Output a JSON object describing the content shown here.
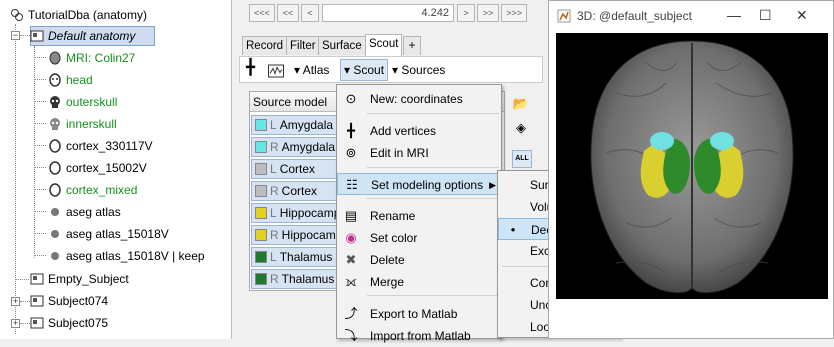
{
  "tree": {
    "items": [
      {
        "label": "TutorialDba (anatomy)"
      },
      {
        "label": "Default anatomy"
      },
      {
        "label": "MRI: Colin27"
      },
      {
        "label": "head"
      },
      {
        "label": "outerskull"
      },
      {
        "label": "innerskull"
      },
      {
        "label": "cortex_330117V"
      },
      {
        "label": "cortex_15002V"
      },
      {
        "label": "cortex_mixed"
      },
      {
        "label": "aseg atlas"
      },
      {
        "label": "aseg atlas_15018V"
      },
      {
        "label": "aseg atlas_15018V | keep"
      },
      {
        "label": "Empty_Subject"
      },
      {
        "label": "Subject074"
      },
      {
        "label": "Subject075"
      }
    ],
    "green_color": "#16901e"
  },
  "nav": {
    "buttons": [
      "<<<",
      "<<",
      "<",
      ">",
      ">>",
      ">>>"
    ],
    "time_value": "4.242"
  },
  "tabs": [
    "Record",
    "Filter",
    "Surface",
    "Scout",
    "+"
  ],
  "toolbar": {
    "atlas_label": "Atlas",
    "scout_label": "Scout",
    "sources_label": "Sources"
  },
  "scout_list": {
    "header": "Source model",
    "rows": [
      {
        "side": "L",
        "name": "Amygdala",
        "color": "#66e6e6"
      },
      {
        "side": "R",
        "name": "Amygdala",
        "color": "#66e6e6"
      },
      {
        "side": "L",
        "name": "Cortex",
        "color": "#bdbdbd"
      },
      {
        "side": "R",
        "name": "Cortex",
        "color": "#bdbdbd"
      },
      {
        "side": "L",
        "name": "Hippocampus",
        "color": "#e0d020"
      },
      {
        "side": "R",
        "name": "Hippocampus",
        "color": "#e0d020"
      },
      {
        "side": "L",
        "name": "Thalamus",
        "color": "#1f7a2a"
      },
      {
        "side": "R",
        "name": "Thalamus",
        "color": "#1f7a2a"
      }
    ],
    "all_label": "ALL"
  },
  "menu": {
    "items": [
      {
        "label": "New: coordinates",
        "icon": "crosshair-target-icon"
      },
      {
        "label": "Add vertices",
        "icon": "plus-crosshair-icon"
      },
      {
        "label": "Edit in MRI",
        "icon": "target-edit-icon"
      },
      {
        "label": "Set modeling options",
        "icon": "options-list-icon"
      },
      {
        "label": "Rename",
        "icon": "rename-icon"
      },
      {
        "label": "Set color",
        "icon": "color-wheel-icon"
      },
      {
        "label": "Delete",
        "icon": "delete-x-icon"
      },
      {
        "label": "Merge",
        "icon": "merge-icon"
      },
      {
        "label": "Export to Matlab",
        "icon": "matlab-export-icon"
      },
      {
        "label": "Import from Matlab",
        "icon": "matlab-import-icon"
      }
    ]
  },
  "submenu": {
    "items": [
      {
        "label": "Surface"
      },
      {
        "label": "Volume"
      },
      {
        "label": "Deep brain",
        "selected": true
      },
      {
        "label": "Exclude"
      },
      {
        "label": "Constrained"
      },
      {
        "label": "Unconstrained"
      },
      {
        "label": "Loose"
      }
    ]
  },
  "window3d": {
    "title": "3D: @default_subject",
    "controls": [
      "—",
      "☐",
      "✕"
    ]
  },
  "colors": {
    "highlight": "#cde5f7",
    "amygdala": "#66e6e6",
    "hippocampus": "#e0d020",
    "thalamus": "#1f7a2a"
  }
}
